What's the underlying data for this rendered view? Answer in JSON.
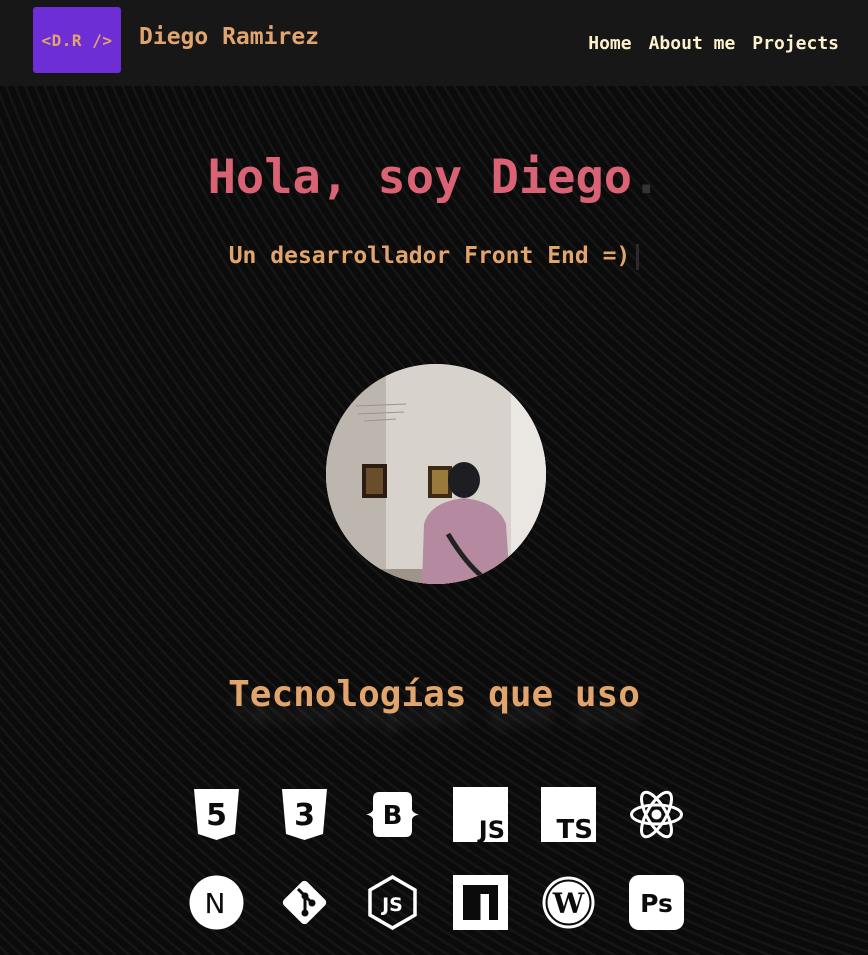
{
  "header": {
    "logo_text": "<D.R />",
    "brand_name": "Diego Ramirez",
    "nav": [
      {
        "label": "Home"
      },
      {
        "label": "About me"
      },
      {
        "label": "Projects"
      }
    ]
  },
  "hero": {
    "title": "Hola, soy Diego",
    "title_suffix": ".",
    "subtitle": "Un desarrollador Front End =)"
  },
  "technologies": {
    "title": "Tecnologías que uso",
    "items": [
      {
        "icon": "html5-icon",
        "label": "5"
      },
      {
        "icon": "css3-icon",
        "label": "3"
      },
      {
        "icon": "bootstrap-icon",
        "label": "B"
      },
      {
        "icon": "javascript-icon",
        "label": "JS"
      },
      {
        "icon": "typescript-icon",
        "label": "TS"
      },
      {
        "icon": "react-icon"
      },
      {
        "icon": "nextjs-icon",
        "label": "N"
      },
      {
        "icon": "git-icon"
      },
      {
        "icon": "nodejs-icon",
        "label": "JS"
      },
      {
        "icon": "npm-icon",
        "label": "n"
      },
      {
        "icon": "wordpress-icon",
        "label": "W"
      },
      {
        "icon": "photoshop-icon",
        "label": "Ps"
      }
    ]
  },
  "colors": {
    "accent_purple": "#6d2ed6",
    "accent_orange": "#e1a46c",
    "accent_pink": "#d96374",
    "nav_text": "#fdf1cc",
    "header_bg": "#171717",
    "page_bg": "#0b0b0b"
  }
}
